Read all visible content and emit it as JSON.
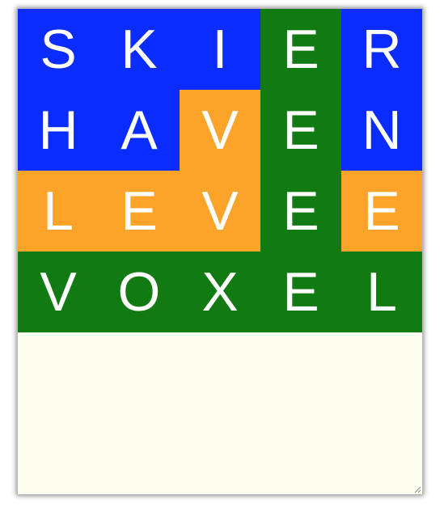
{
  "colors": {
    "blue": "#0a2cff",
    "orange": "#fca32a",
    "green": "#117a13",
    "background": "#fdfdf0"
  },
  "grid": {
    "rows": [
      {
        "tiles": [
          {
            "letter": "S",
            "color": "blue"
          },
          {
            "letter": "K",
            "color": "blue"
          },
          {
            "letter": "I",
            "color": "blue"
          },
          {
            "letter": "E",
            "color": "green"
          },
          {
            "letter": "R",
            "color": "blue"
          }
        ]
      },
      {
        "tiles": [
          {
            "letter": "H",
            "color": "blue"
          },
          {
            "letter": "A",
            "color": "blue"
          },
          {
            "letter": "V",
            "color": "orange"
          },
          {
            "letter": "E",
            "color": "green"
          },
          {
            "letter": "N",
            "color": "blue"
          }
        ]
      },
      {
        "tiles": [
          {
            "letter": "L",
            "color": "orange"
          },
          {
            "letter": "E",
            "color": "orange"
          },
          {
            "letter": "V",
            "color": "orange"
          },
          {
            "letter": "E",
            "color": "green"
          },
          {
            "letter": "E",
            "color": "orange"
          }
        ]
      },
      {
        "tiles": [
          {
            "letter": "V",
            "color": "green"
          },
          {
            "letter": "O",
            "color": "green"
          },
          {
            "letter": "X",
            "color": "green"
          },
          {
            "letter": "E",
            "color": "green"
          },
          {
            "letter": "L",
            "color": "green"
          }
        ]
      }
    ]
  },
  "icons": {
    "resize_grip": "resize-grip-icon"
  }
}
